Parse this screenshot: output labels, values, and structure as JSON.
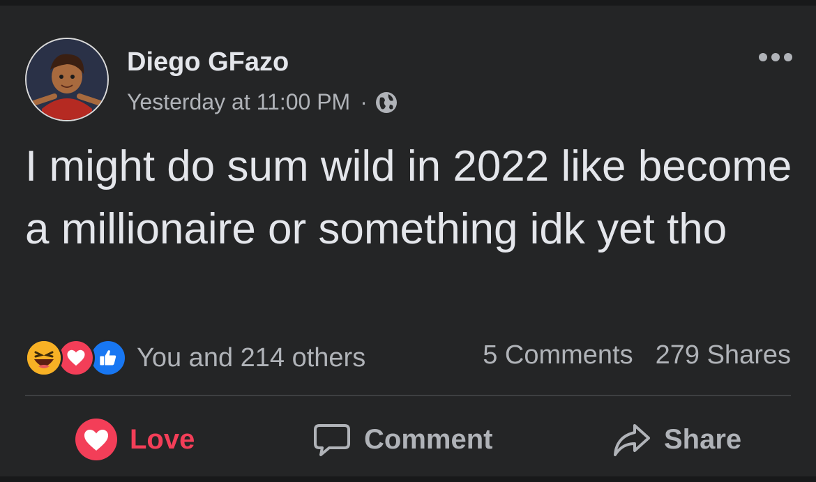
{
  "post": {
    "author": "Diego GFazo",
    "timestamp": "Yesterday at 11:00 PM",
    "separator": "·",
    "privacy_icon": "globe-icon",
    "text": "I might do sum wild in 2022 like become a millionaire or something idk yet tho"
  },
  "reactions": {
    "icons": [
      "haha-icon",
      "love-icon",
      "like-icon"
    ],
    "summary": "You and 214 others",
    "comments": "5 Comments",
    "shares": "279 Shares"
  },
  "actions": {
    "love_label": "Love",
    "comment_label": "Comment",
    "share_label": "Share"
  },
  "colors": {
    "background": "#242526",
    "text": "#e4e6eb",
    "secondary": "#b0b3b8",
    "love": "#f33e58",
    "like": "#1877f2",
    "haha": "#f7b125"
  }
}
